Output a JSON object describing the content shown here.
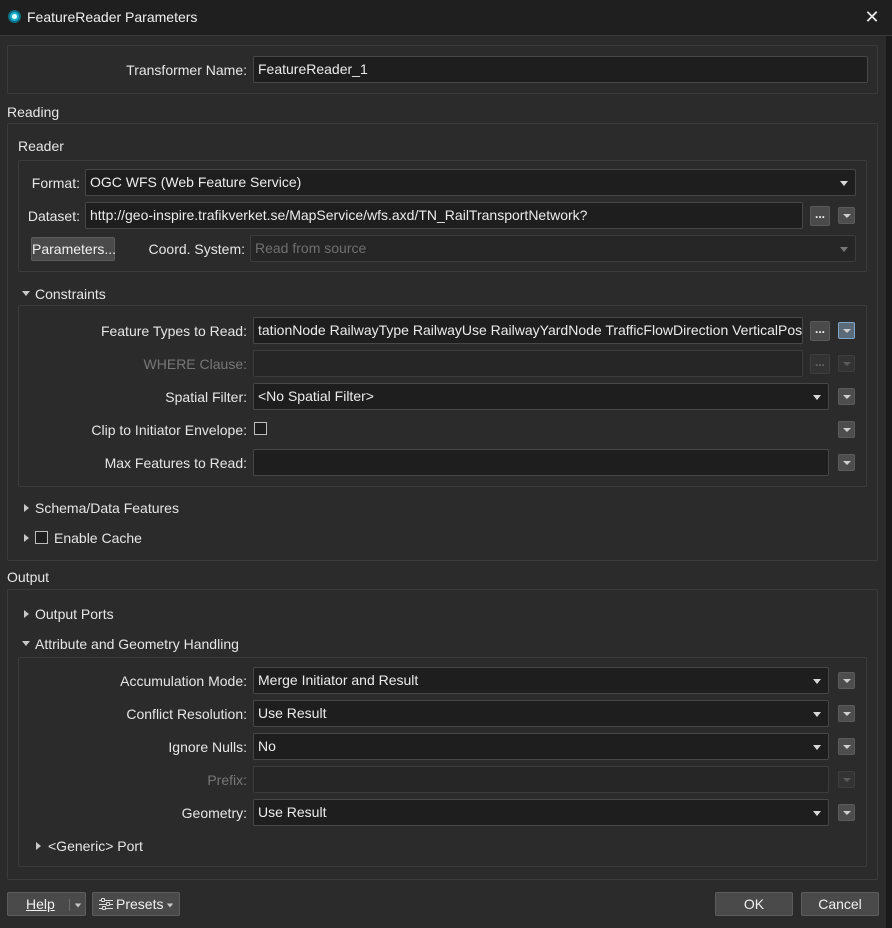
{
  "window": {
    "title": "FeatureReader Parameters",
    "close_glyph": "✕"
  },
  "transformer": {
    "label": "Transformer Name:",
    "value": "FeatureReader_1"
  },
  "reading": {
    "section_label": "Reading",
    "reader_label": "Reader",
    "format_label": "Format:",
    "format_value": "OGC WFS (Web Feature Service)",
    "dataset_label": "Dataset:",
    "dataset_value": "http://geo-inspire.trafikverket.se/MapService/wfs.axd/TN_RailTransportNetwork?",
    "parameters_button": "Parameters...",
    "coord_label": "Coord. System:",
    "coord_value": "Read from source"
  },
  "constraints": {
    "header": "Constraints",
    "feature_types_label": "Feature Types to Read:",
    "feature_types_value": "tationNode RailwayType RailwayUse RailwayYardNode TrafficFlowDirection VerticalPosition",
    "where_label": "WHERE Clause:",
    "where_value": "",
    "spatial_label": "Spatial Filter:",
    "spatial_value": "<No Spatial Filter>",
    "clip_label": "Clip to Initiator Envelope:",
    "clip_checked": false,
    "max_label": "Max Features to Read:",
    "max_value": ""
  },
  "schema": {
    "header": "Schema/Data Features"
  },
  "cache": {
    "label": "Enable Cache",
    "checked": false
  },
  "output": {
    "section_label": "Output",
    "ports_header": "Output Ports",
    "handling_header": "Attribute and Geometry Handling",
    "accumulation_label": "Accumulation Mode:",
    "accumulation_value": "Merge Initiator and Result",
    "conflict_label": "Conflict Resolution:",
    "conflict_value": "Use Result",
    "nulls_label": "Ignore Nulls:",
    "nulls_value": "No",
    "prefix_label": "Prefix:",
    "prefix_value": "",
    "geometry_label": "Geometry:",
    "geometry_value": "Use Result",
    "generic_port_header": "<Generic> Port"
  },
  "footer": {
    "help": "Help",
    "presets": "Presets",
    "ok": "OK",
    "cancel": "Cancel"
  },
  "ellipsis": "...",
  "colors": {
    "accent": "#1bb3d1",
    "background": "#2b2b2b",
    "field": "#1e1e1e",
    "button": "#4a4a4a"
  }
}
